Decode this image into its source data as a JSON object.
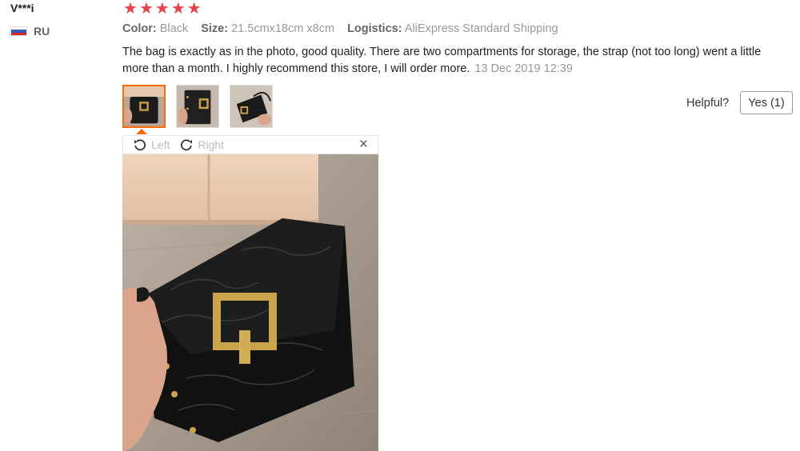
{
  "reviewer": {
    "name": "V***i",
    "country": "RU",
    "flag_colors": [
      "#ffffff",
      "#2e5cb8",
      "#d52b1e"
    ]
  },
  "rating": {
    "stars": 5,
    "max": 5,
    "color": "#e9414d"
  },
  "meta": {
    "color_label": "Color:",
    "color_value": "Black",
    "size_label": "Size:",
    "size_value": "21.5cmx18cm x8cm",
    "logistics_label": "Logistics:",
    "logistics_value": "AliExpress Standard Shipping"
  },
  "review": {
    "text": "The bag is exactly as in the photo, good quality. There are two compartments for storage, the strap (not too long) went a little more than a month. I highly recommend this store, I will order more.",
    "date": "13 Dec 2019 12:39"
  },
  "thumbnails": [
    {
      "name": "photo-1",
      "selected": true
    },
    {
      "name": "photo-2",
      "selected": false
    },
    {
      "name": "photo-3",
      "selected": false
    }
  ],
  "viewer": {
    "rotate_left": "Left",
    "rotate_right": "Right",
    "close": "×"
  },
  "helpful": {
    "label": "Helpful?",
    "yes_button": "Yes (1)"
  },
  "colors": {
    "accent": "#ff6a00",
    "meta_gray": "#999999"
  }
}
